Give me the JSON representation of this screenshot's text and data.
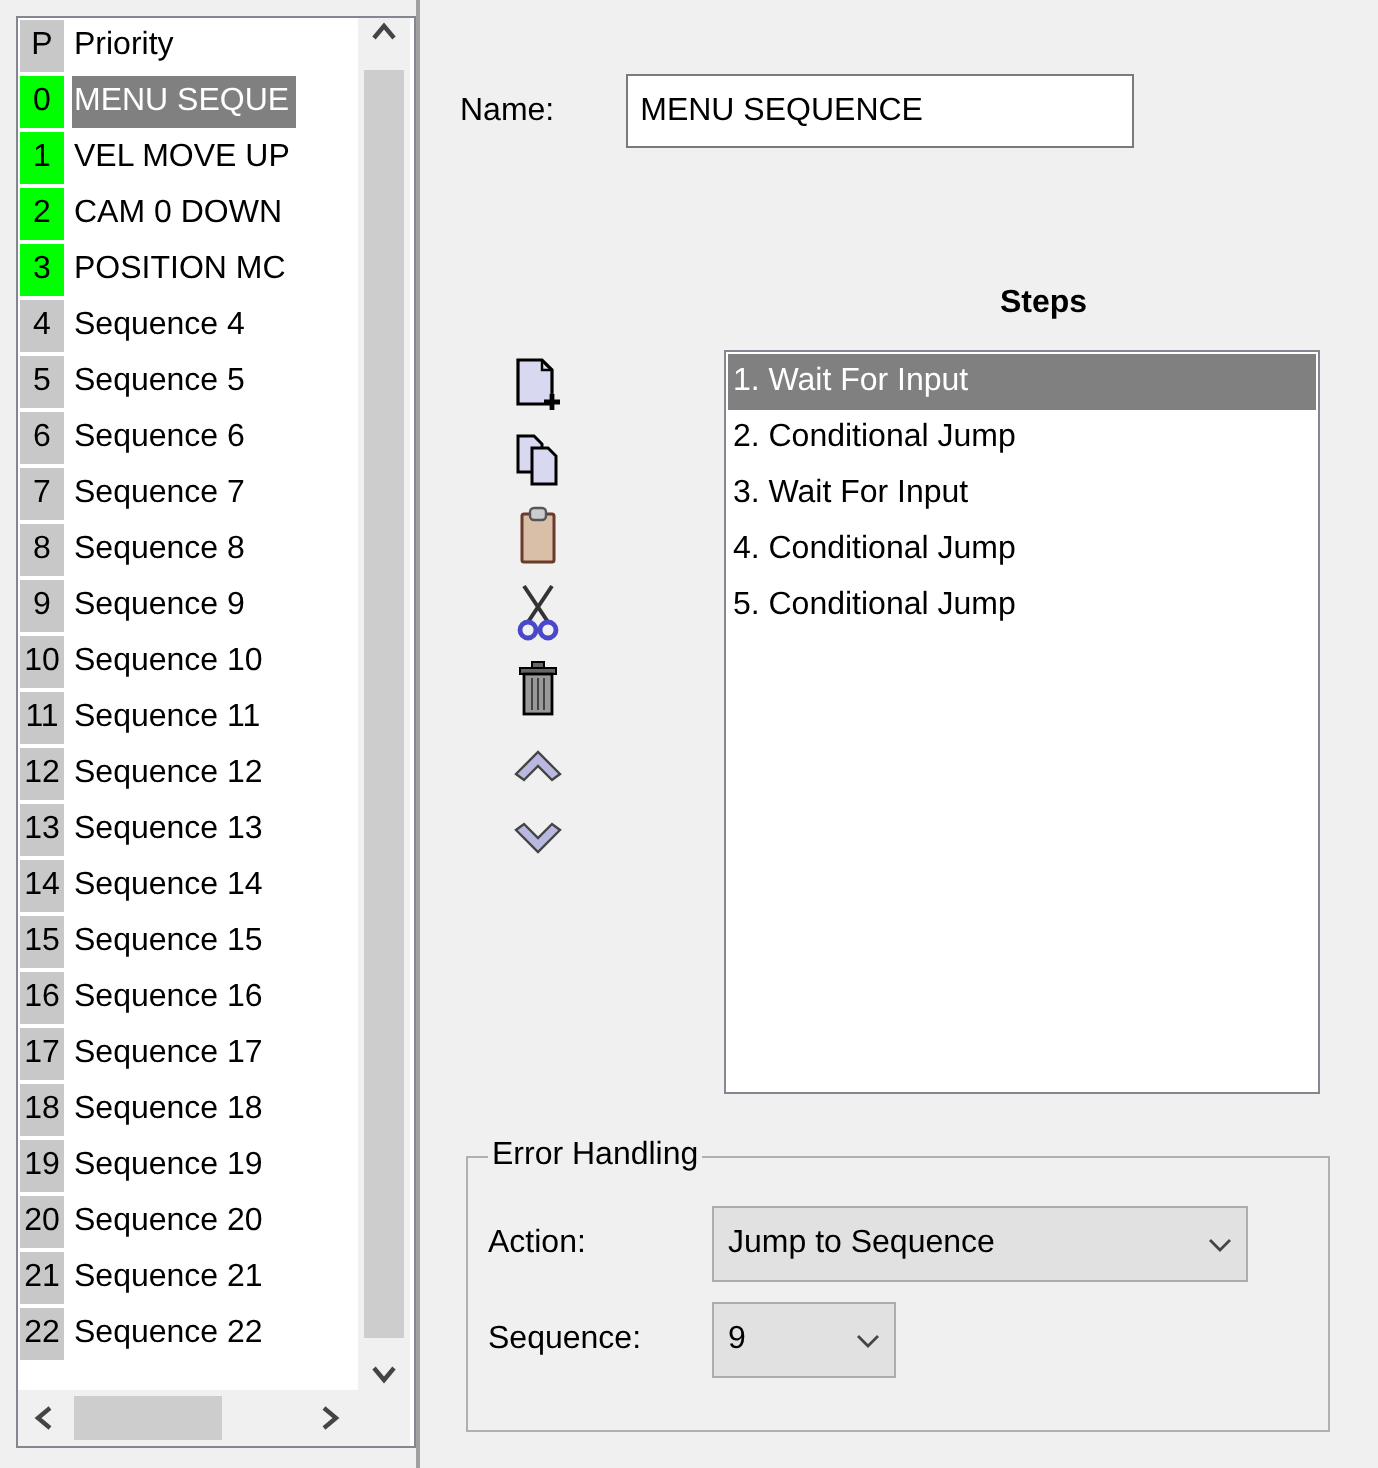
{
  "sequence_list": {
    "columns": [
      "P",
      "Priority"
    ],
    "rows": [
      {
        "number": "0",
        "name": "MENU SEQUE",
        "color": "#00ff00",
        "selected": true
      },
      {
        "number": "1",
        "name": "VEL MOVE UP",
        "color": "#00ff00",
        "selected": false
      },
      {
        "number": "2",
        "name": "CAM 0 DOWN",
        "color": "#00ff00",
        "selected": false
      },
      {
        "number": "3",
        "name": "POSITION MC",
        "color": "#00ff00",
        "selected": false
      },
      {
        "number": "4",
        "name": "Sequence 4",
        "color": "#c8c8c8",
        "selected": false
      },
      {
        "number": "5",
        "name": "Sequence 5",
        "color": "#c8c8c8",
        "selected": false
      },
      {
        "number": "6",
        "name": "Sequence 6",
        "color": "#c8c8c8",
        "selected": false
      },
      {
        "number": "7",
        "name": "Sequence 7",
        "color": "#c8c8c8",
        "selected": false
      },
      {
        "number": "8",
        "name": "Sequence 8",
        "color": "#c8c8c8",
        "selected": false
      },
      {
        "number": "9",
        "name": "Sequence 9",
        "color": "#c8c8c8",
        "selected": false
      },
      {
        "number": "10",
        "name": "Sequence 10",
        "color": "#c8c8c8",
        "selected": false
      },
      {
        "number": "11",
        "name": "Sequence 11",
        "color": "#c8c8c8",
        "selected": false
      },
      {
        "number": "12",
        "name": "Sequence 12",
        "color": "#c8c8c8",
        "selected": false
      },
      {
        "number": "13",
        "name": "Sequence 13",
        "color": "#c8c8c8",
        "selected": false
      },
      {
        "number": "14",
        "name": "Sequence 14",
        "color": "#c8c8c8",
        "selected": false
      },
      {
        "number": "15",
        "name": "Sequence 15",
        "color": "#c8c8c8",
        "selected": false
      },
      {
        "number": "16",
        "name": "Sequence 16",
        "color": "#c8c8c8",
        "selected": false
      },
      {
        "number": "17",
        "name": "Sequence 17",
        "color": "#c8c8c8",
        "selected": false
      },
      {
        "number": "18",
        "name": "Sequence 18",
        "color": "#c8c8c8",
        "selected": false
      },
      {
        "number": "19",
        "name": "Sequence 19",
        "color": "#c8c8c8",
        "selected": false
      },
      {
        "number": "20",
        "name": "Sequence 20",
        "color": "#c8c8c8",
        "selected": false
      },
      {
        "number": "21",
        "name": "Sequence 21",
        "color": "#c8c8c8",
        "selected": false
      },
      {
        "number": "22",
        "name": "Sequence 22",
        "color": "#c8c8c8",
        "selected": false
      }
    ]
  },
  "editor": {
    "name_label": "Name:",
    "name_value": "MENU SEQUENCE",
    "steps_title": "Steps",
    "toolbar": [
      {
        "kind": "new"
      },
      {
        "kind": "copy"
      },
      {
        "kind": "paste"
      },
      {
        "kind": "cut"
      },
      {
        "kind": "delete"
      },
      {
        "kind": "up"
      },
      {
        "kind": "down"
      }
    ],
    "steps": [
      {
        "label": "1. Wait For Input",
        "selected": true
      },
      {
        "label": "2. Conditional Jump",
        "selected": false
      },
      {
        "label": "3. Wait For Input",
        "selected": false
      },
      {
        "label": "4. Conditional Jump",
        "selected": false
      },
      {
        "label": "5. Conditional Jump",
        "selected": false
      }
    ],
    "error_handling": {
      "title": "Error Handling",
      "action_label": "Action:",
      "action_value": "Jump to Sequence",
      "sequence_label": "Sequence:",
      "sequence_value": "9"
    }
  }
}
